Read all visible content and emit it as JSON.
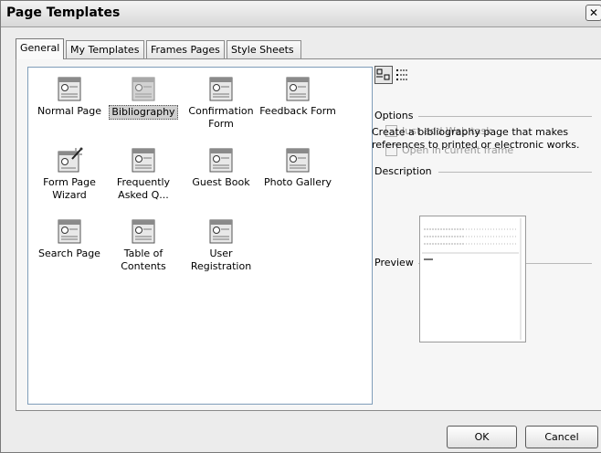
{
  "window": {
    "title": "Page Templates",
    "close_glyph": "✕"
  },
  "tabs": [
    {
      "label": "General",
      "active": true
    },
    {
      "label": "My Templates",
      "active": false
    },
    {
      "label": "Frames Pages",
      "active": false
    },
    {
      "label": "Style Sheets",
      "active": false
    }
  ],
  "templates": [
    {
      "label": "Normal Page",
      "icon": "page-template-icon",
      "selected": false
    },
    {
      "label": "Bibliography",
      "icon": "page-template-icon",
      "selected": true
    },
    {
      "label": "Confirmation Form",
      "icon": "page-template-icon",
      "selected": false
    },
    {
      "label": "Feedback Form",
      "icon": "page-template-icon",
      "selected": false
    },
    {
      "label": "Form Page Wizard",
      "icon": "wizard-template-icon",
      "selected": false
    },
    {
      "label": "Frequently Asked Q...",
      "icon": "page-template-icon",
      "selected": false
    },
    {
      "label": "Guest Book",
      "icon": "page-template-icon",
      "selected": false
    },
    {
      "label": "Photo Gallery",
      "icon": "page-template-icon",
      "selected": false
    },
    {
      "label": "Search Page",
      "icon": "page-template-icon",
      "selected": false
    },
    {
      "label": "Table of Contents",
      "icon": "page-template-icon",
      "selected": false
    },
    {
      "label": "User Registration",
      "icon": "page-template-icon",
      "selected": false
    }
  ],
  "view_buttons": [
    {
      "name": "large-icons-view-icon",
      "pressed": true
    },
    {
      "name": "list-view-icon",
      "pressed": false
    }
  ],
  "options": {
    "heading": "Options",
    "just_add_web_task": {
      "label": "Just add Web task",
      "checked": false,
      "enabled": false
    },
    "open_in_current_frame": {
      "label": "Open in current frame",
      "checked": false,
      "enabled": false
    }
  },
  "description": {
    "heading": "Description",
    "text": "Create a bibliography page that makes references to printed or electronic works."
  },
  "preview": {
    "heading": "Preview"
  },
  "buttons": {
    "ok": "OK",
    "cancel": "Cancel"
  }
}
